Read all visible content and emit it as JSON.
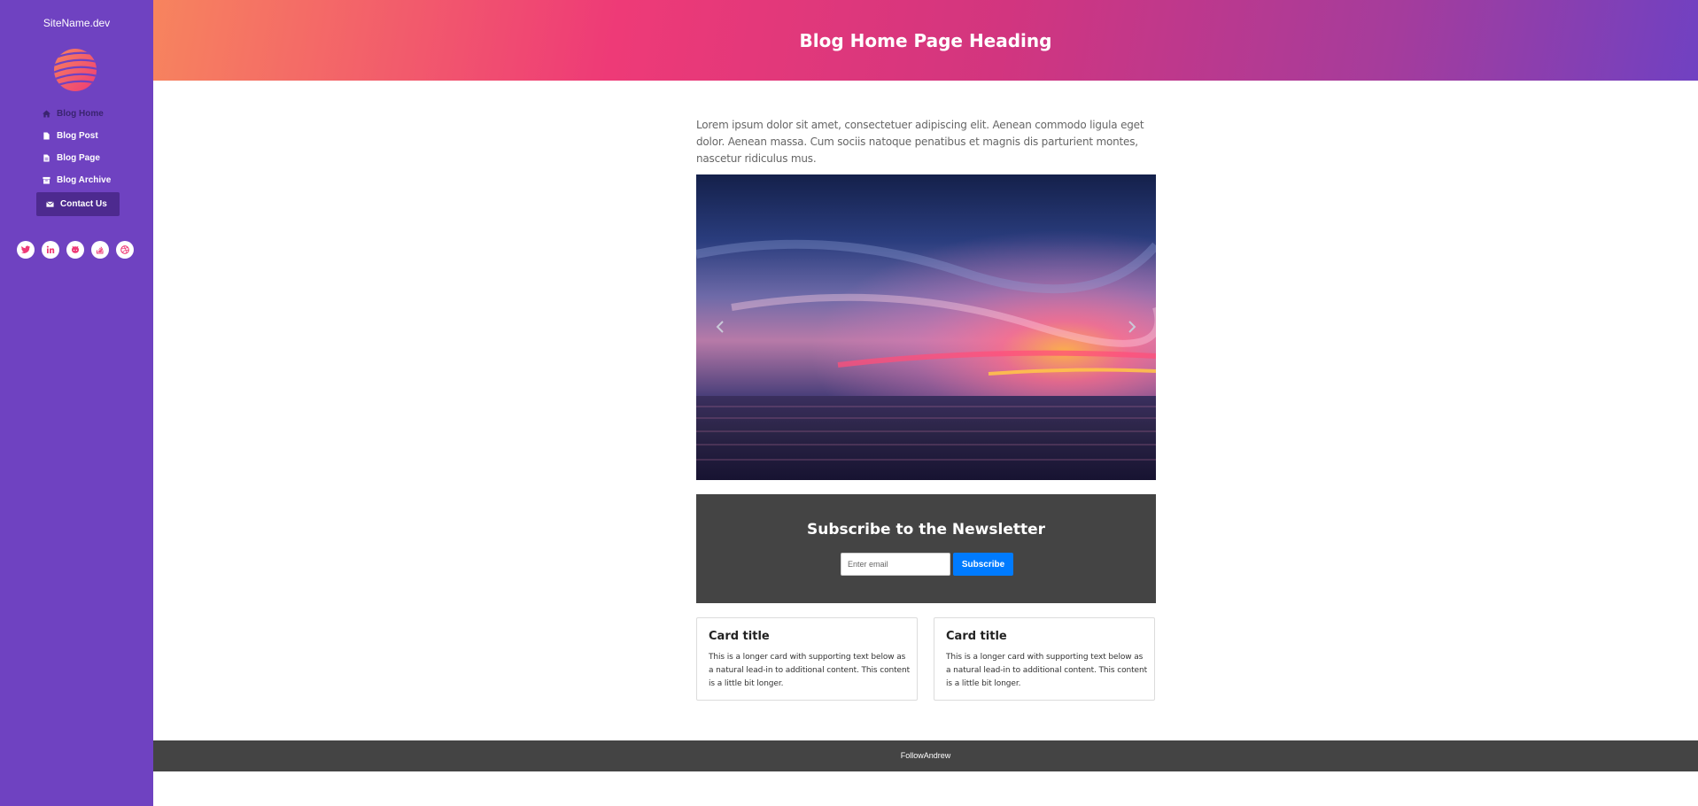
{
  "sidebar": {
    "site_name": "SiteName.dev",
    "items": [
      {
        "label": "Blog Home",
        "icon": "home-icon"
      },
      {
        "label": "Blog Post",
        "icon": "file-icon"
      },
      {
        "label": "Blog Page",
        "icon": "file-text-icon"
      },
      {
        "label": "Blog Archive",
        "icon": "archive-icon"
      },
      {
        "label": "Contact Us",
        "icon": "envelope-icon",
        "active": true
      }
    ],
    "social": [
      "twitter-icon",
      "linkedin-icon",
      "github-icon",
      "stackoverflow-icon",
      "dribbble-icon"
    ],
    "colors": {
      "background": "#6f42c1",
      "active_item": "#4d2a8f",
      "social_icon": "#ee3a77"
    }
  },
  "header": {
    "title": "Blog Home Page Heading",
    "gradient": [
      "#f7845e",
      "#ee3a77",
      "#7041c2"
    ]
  },
  "main": {
    "intro": "Lorem ipsum dolor sit amet, consectetuer adipiscing elit. Aenean commodo ligula eget dolor. Aenean massa. Cum sociis natoque penatibus et magnis dis parturient montes, nascetur ridiculus mus.",
    "carousel": {
      "prev_icon": "chevron-left-icon",
      "next_icon": "chevron-right-icon"
    },
    "newsletter": {
      "title": "Subscribe to the Newsletter",
      "placeholder": "Enter email",
      "button": "Subscribe",
      "button_color": "#007bff"
    },
    "cards": [
      {
        "title": "Card title",
        "text": "This is a longer card with supporting text below as a natural lead-in to additional content. This content is a little bit longer."
      },
      {
        "title": "Card title",
        "text": "This is a longer card with supporting text below as a natural lead-in to additional content. This content is a little bit longer."
      }
    ]
  },
  "footer": {
    "text": "FollowAndrew"
  }
}
